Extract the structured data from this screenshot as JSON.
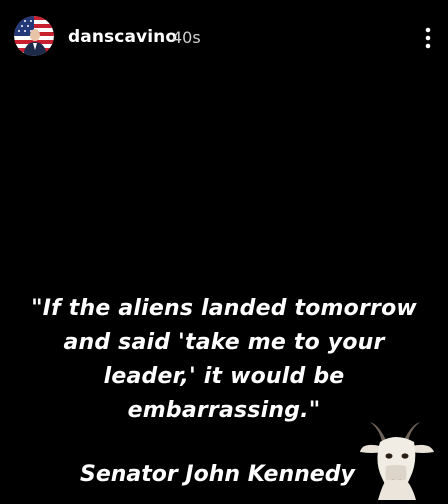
{
  "header": {
    "username": "danscavino",
    "time_ago": "40s",
    "avatar_icon": "flag-avatar-icon",
    "menu_icon": "more-vertical-icon"
  },
  "story": {
    "quote_lines": [
      "\"If the aliens landed tomorrow",
      "and said 'take me to your",
      "leader,' it would be",
      "embarrassing.\""
    ],
    "attribution": "Senator John Kennedy",
    "sticker_icon": "goat-sticker-icon"
  },
  "colors": {
    "background": "#000000",
    "text": "#ffffff",
    "timestamp": "#d0d0d0"
  }
}
